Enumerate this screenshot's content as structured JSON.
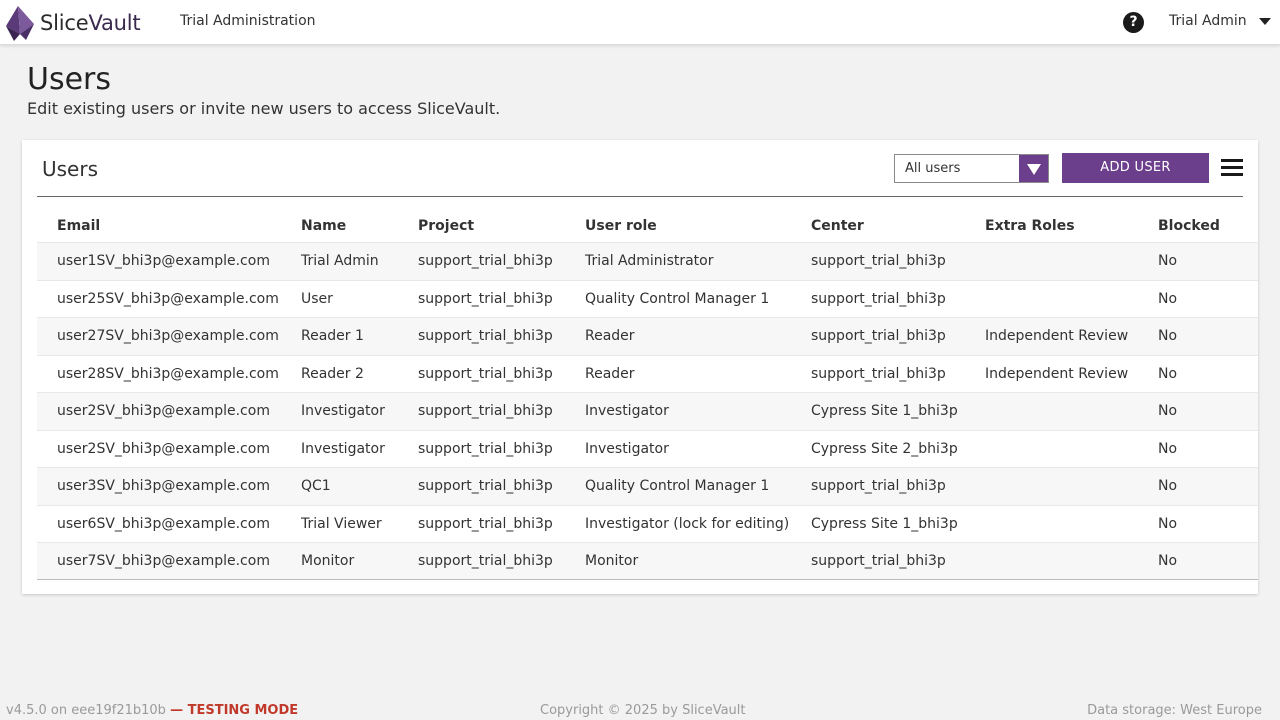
{
  "brand": {
    "name_part1": "Slice",
    "name_part2": "Vault",
    "accent_color": "#6b3f8c"
  },
  "topbar": {
    "app_title": "Trial Administration",
    "help_icon": "question-circle-icon",
    "help_glyph": "?",
    "user_name": "Trial Admin"
  },
  "header": {
    "title": "Users",
    "subtitle": "Edit existing users or invite new users to access SliceVault."
  },
  "card": {
    "title": "Users",
    "filter": {
      "selected": "All users"
    },
    "add_button_label": "ADD USER",
    "menu_icon": "hamburger-menu-icon"
  },
  "table": {
    "columns": [
      "Email",
      "Name",
      "Project",
      "User role",
      "Center",
      "Extra Roles",
      "Blocked"
    ],
    "rows": [
      {
        "email": "user1SV_bhi3p@example.com",
        "name": "Trial Admin",
        "project": "support_trial_bhi3p",
        "role": "Trial Administrator",
        "center": "support_trial_bhi3p",
        "extra": "",
        "blocked": "No"
      },
      {
        "email": "user25SV_bhi3p@example.com",
        "name": "User",
        "project": "support_trial_bhi3p",
        "role": "Quality Control Manager 1",
        "center": "support_trial_bhi3p",
        "extra": "",
        "blocked": "No"
      },
      {
        "email": "user27SV_bhi3p@example.com",
        "name": "Reader 1",
        "project": "support_trial_bhi3p",
        "role": "Reader",
        "center": "support_trial_bhi3p",
        "extra": "Independent Review",
        "blocked": "No"
      },
      {
        "email": "user28SV_bhi3p@example.com",
        "name": "Reader 2",
        "project": "support_trial_bhi3p",
        "role": "Reader",
        "center": "support_trial_bhi3p",
        "extra": "Independent Review",
        "blocked": "No"
      },
      {
        "email": "user2SV_bhi3p@example.com",
        "name": "Investigator",
        "project": "support_trial_bhi3p",
        "role": "Investigator",
        "center": "Cypress Site 1_bhi3p",
        "extra": "",
        "blocked": "No"
      },
      {
        "email": "user2SV_bhi3p@example.com",
        "name": "Investigator",
        "project": "support_trial_bhi3p",
        "role": "Investigator",
        "center": "Cypress Site 2_bhi3p",
        "extra": "",
        "blocked": "No"
      },
      {
        "email": "user3SV_bhi3p@example.com",
        "name": "QC1",
        "project": "support_trial_bhi3p",
        "role": "Quality Control Manager 1",
        "center": "support_trial_bhi3p",
        "extra": "",
        "blocked": "No"
      },
      {
        "email": "user6SV_bhi3p@example.com",
        "name": "Trial Viewer",
        "project": "support_trial_bhi3p",
        "role": "Investigator (lock for editing)",
        "center": "Cypress Site 1_bhi3p",
        "extra": "",
        "blocked": "No"
      },
      {
        "email": "user7SV_bhi3p@example.com",
        "name": "Monitor",
        "project": "support_trial_bhi3p",
        "role": "Monitor",
        "center": "support_trial_bhi3p",
        "extra": "",
        "blocked": "No"
      }
    ]
  },
  "footer": {
    "version": "v4.5.0 on eee19f21b10b",
    "mode": "— TESTING MODE",
    "copyright": "Copyright © 2025 by SliceVault",
    "storage": "Data storage: West Europe"
  }
}
